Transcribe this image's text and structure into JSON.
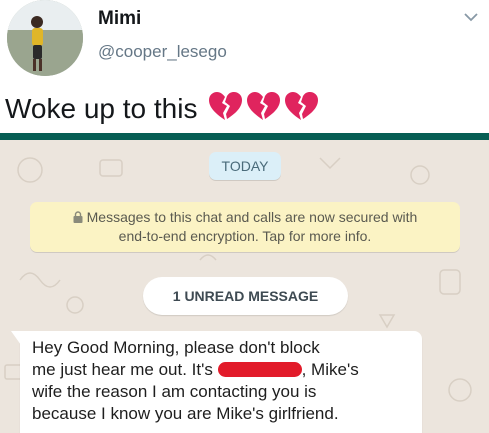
{
  "tweet": {
    "display_name": "Mimi",
    "handle": "@cooper_lesego",
    "text": "Woke up to this",
    "emoji_icon": "broken-heart-icon"
  },
  "chat": {
    "date_label": "TODAY",
    "encryption_notice": {
      "line1": "Messages to this chat and calls are now secured with",
      "line2": "end-to-end encryption. Tap for more info."
    },
    "unread_label": "1 UNREAD MESSAGE",
    "message": {
      "line1": "Hey Good Morning, please don't block",
      "line2_before": "me just hear me out. It's",
      "line2_after": ", Mike's",
      "line3": "wife the reason I am contacting you is",
      "line4": "because I know you are Mike's girlfriend."
    }
  },
  "colors": {
    "whatsapp_header": "#075e54",
    "chat_background": "#ece5dd",
    "notice_background": "#fbf3c4",
    "redaction": "#e21b2a",
    "heart": "#e0245e"
  }
}
